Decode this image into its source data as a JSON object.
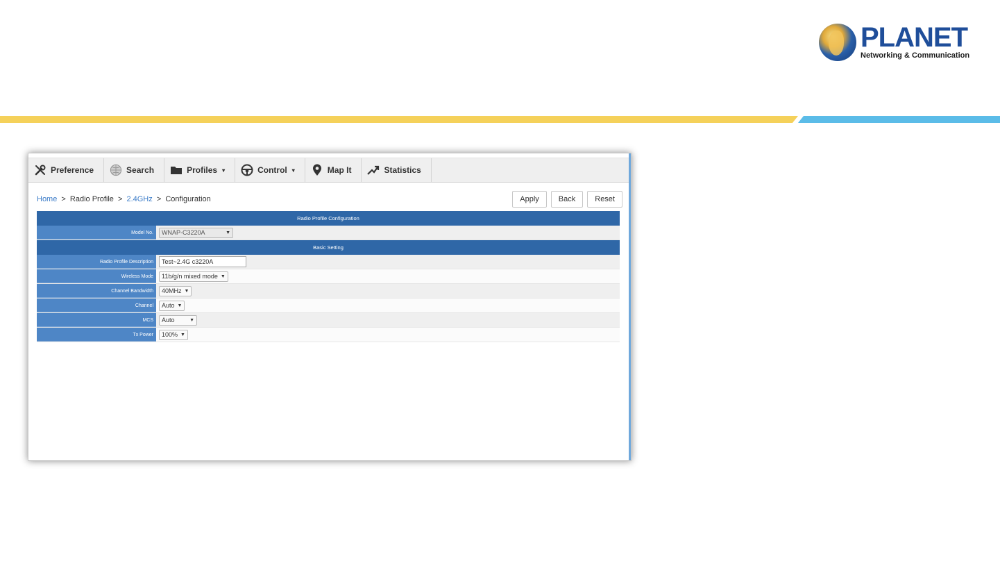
{
  "brand": {
    "name": "PLANET",
    "tagline": "Networking & Communication",
    "colors": {
      "stripe_yellow": "#f5d15a",
      "stripe_blue": "#5bbce8",
      "header_blue": "#2f67a7",
      "label_blue": "#4e86c6",
      "link": "#3a7bc8"
    }
  },
  "nav": {
    "items": [
      {
        "label": "Preference",
        "icon": "wrench-screwdriver-icon"
      },
      {
        "label": "Search",
        "icon": "globe-search-icon"
      },
      {
        "label": "Profiles",
        "icon": "folder-icon",
        "caret": "▾"
      },
      {
        "label": "Control",
        "icon": "steering-wheel-icon",
        "caret": "▾"
      },
      {
        "label": "Map It",
        "icon": "map-pin-icon"
      },
      {
        "label": "Statistics",
        "icon": "trend-arrow-icon"
      }
    ]
  },
  "breadcrumb": {
    "home": "Home",
    "sep": ">",
    "radio_profile": "Radio Profile",
    "band": "2.4GHz",
    "page": "Configuration"
  },
  "buttons": {
    "apply": "Apply",
    "back": "Back",
    "reset": "Reset"
  },
  "form": {
    "section_title": "Radio Profile Configuration",
    "model_label": "Model No.",
    "model_value": "WNAP-C3220A",
    "basic_title": "Basic Setting",
    "rows": [
      {
        "label": "Radio Profile Description",
        "value": "Test~2.4G c3220A"
      },
      {
        "label": "Wireless Mode",
        "value": "11b/g/n mixed mode"
      },
      {
        "label": "Channel Bandwidth",
        "value": "40MHz"
      },
      {
        "label": "Channel",
        "value": "Auto"
      },
      {
        "label": "MCS",
        "value": "Auto"
      },
      {
        "label": "Tx Power",
        "value": "100%"
      }
    ],
    "arrow": "▼"
  }
}
